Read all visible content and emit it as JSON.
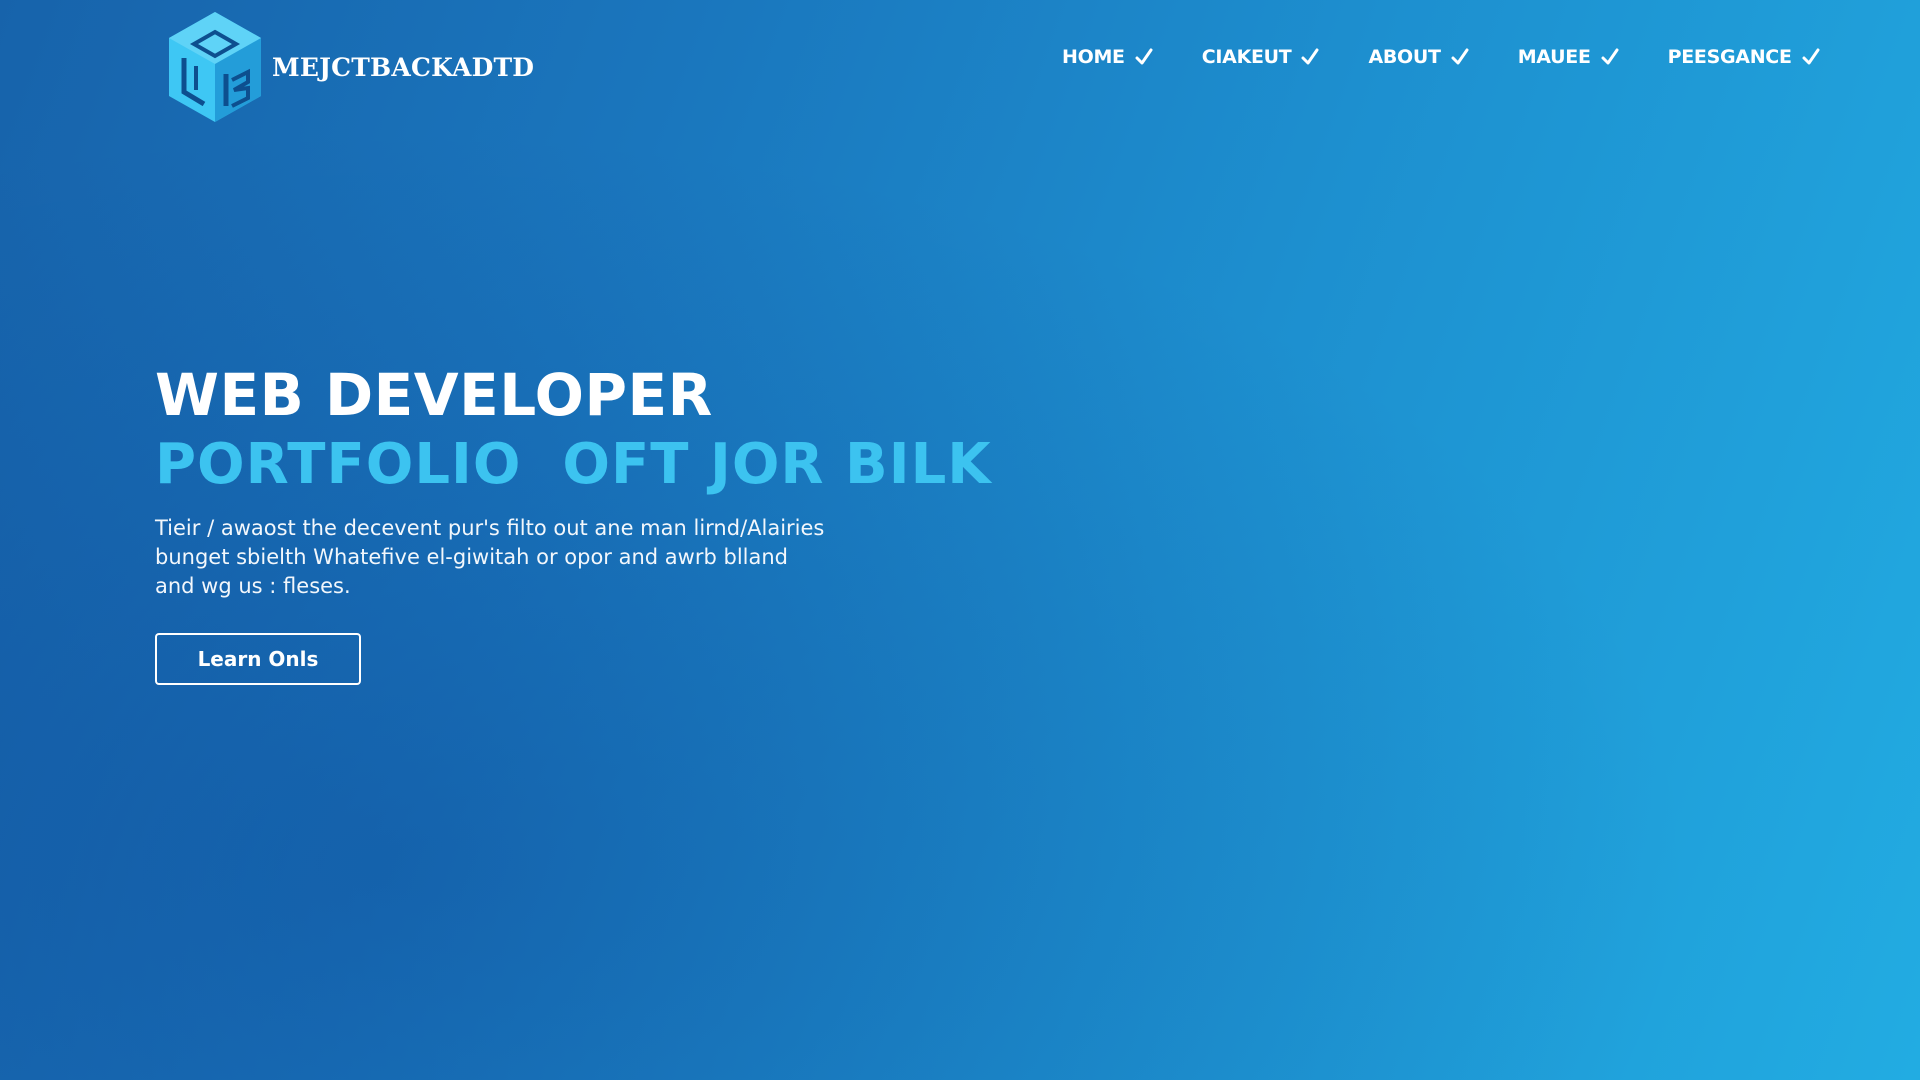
{
  "header": {
    "brand": {
      "name": "MEJCTBACKADTD",
      "logo_icon": "hexagon-cube-logo-icon"
    },
    "nav": [
      {
        "label": "HOME",
        "icon": "check-icon"
      },
      {
        "label": "CIAKEUT",
        "icon": "check-icon"
      },
      {
        "label": "ABOUT",
        "icon": "check-icon"
      },
      {
        "label": "MAUEE",
        "icon": "check-icon"
      },
      {
        "label": "PEESGANCE",
        "icon": "check-icon"
      }
    ]
  },
  "hero": {
    "title": "WEB DEVELOPER",
    "subtitle": "PORTFOLIO  OFT JOR BILK",
    "description": [
      "Tieir / awaost the decevent pur's filto out ane man lirnd/Alairies",
      "bunget sbielth Whatefive el-giwitah or opor and awrb blland",
      "and wg us : fleses."
    ],
    "cta_label": "Learn Onls"
  },
  "colors": {
    "background_start": "#1763ab",
    "background_end": "#22ace2",
    "accent": "#3cc3f0",
    "logo_face_light": "#3ec7f4",
    "logo_face_dark": "#1b8fd0",
    "text": "#ffffff"
  }
}
